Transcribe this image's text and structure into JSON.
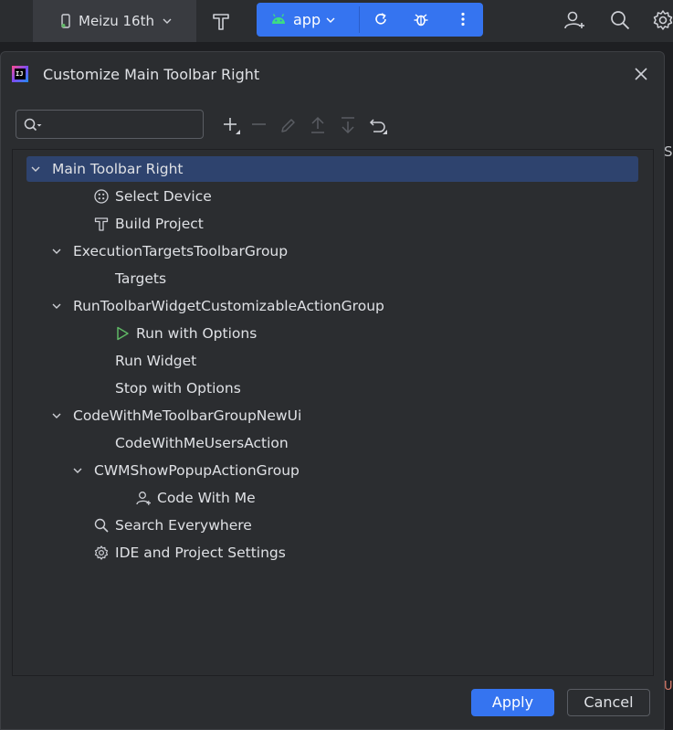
{
  "ide_toolbar": {
    "device_label": "Meizu 16th",
    "run_config_label": "app",
    "right_fragment_text": "S",
    "bottom_fragment_text": "U"
  },
  "dialog": {
    "title": "Customize Main Toolbar Right",
    "search": {
      "value": "",
      "placeholder": ""
    },
    "apply_label": "Apply",
    "cancel_label": "Cancel"
  },
  "tree": [
    {
      "label": "Main Toolbar Right",
      "level": 0,
      "expanded": true,
      "icon": "",
      "selected": true
    },
    {
      "label": "Select Device",
      "level": 1,
      "icon": "select-device-icon"
    },
    {
      "label": "Build Project",
      "level": 1,
      "icon": "hammer-icon"
    },
    {
      "label": "ExecutionTargetsToolbarGroup",
      "level": 1,
      "expanded": true,
      "icon": ""
    },
    {
      "label": "Targets",
      "level": 2,
      "icon": ""
    },
    {
      "label": "RunToolbarWidgetCustomizableActionGroup",
      "level": 1,
      "expanded": true,
      "icon": ""
    },
    {
      "label": "Run with Options",
      "level": 2,
      "icon": "run-icon"
    },
    {
      "label": "Run Widget",
      "level": 2,
      "icon": ""
    },
    {
      "label": "Stop with Options",
      "level": 2,
      "icon": ""
    },
    {
      "label": "CodeWithMeToolbarGroupNewUi",
      "level": 1,
      "expanded": true,
      "icon": ""
    },
    {
      "label": "CodeWithMeUsersAction",
      "level": 2,
      "icon": ""
    },
    {
      "label": "CWMShowPopupActionGroup",
      "level": 2,
      "expanded": true,
      "icon": ""
    },
    {
      "label": "Code With Me",
      "level": 3,
      "icon": "add-user-icon"
    },
    {
      "label": "Search Everywhere",
      "level": 1,
      "icon": "search-icon"
    },
    {
      "label": "IDE and Project Settings",
      "level": 1,
      "icon": "gear-icon"
    }
  ],
  "colors": {
    "accent": "#3574f0",
    "selection": "#2e436e",
    "run_green": "#5fb865",
    "android_green": "#3ddc84"
  }
}
